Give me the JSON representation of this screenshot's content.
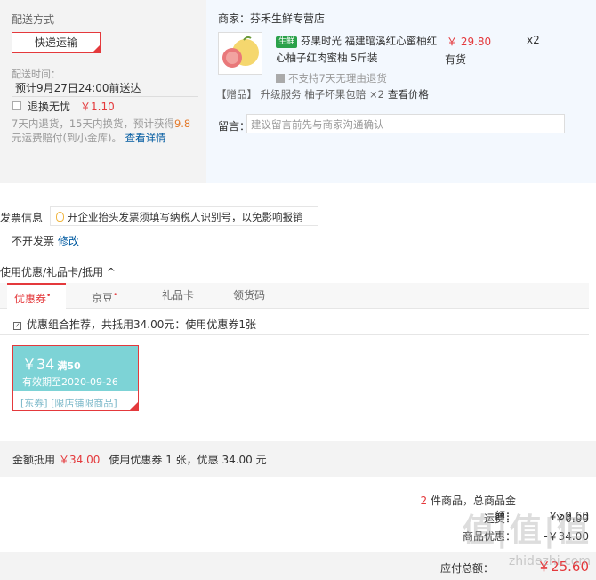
{
  "shipping": {
    "title": "配送方式",
    "mode": "快递运输",
    "time_label": "配送时间：",
    "time_value": "预计9月27日24:00前送达",
    "return_label": "退换无忧",
    "return_price": "￥1.10",
    "desc_pre": "7天内退货，15天内换货，预计获得",
    "desc_num": "9.8",
    "desc_post": "元运费赔付(到小金库)。",
    "detail_link": "查看详情"
  },
  "store": {
    "merchant": "商家：芬禾生鲜专营店",
    "badge": "生鲜",
    "product_title": "芬果时光 福建琯溪红心蜜柚红心柚子红肉蜜柚 5斤装",
    "price": "￥ 29.80",
    "qty": "x2",
    "stock": "有货",
    "no_return": "不支持7天无理由退货",
    "gift_tag": "【赠品】",
    "gift_text": "升级服务 柚子坏果包赔 ×2",
    "gift_link": "查看价格",
    "msg_label": "留言：",
    "msg_placeholder": "建议留言前先与商家沟通确认"
  },
  "invoice": {
    "title": "发票信息",
    "tip": "开企业抬头发票须填写纳税人识别号，以免影响报销",
    "status": "不开发票",
    "edit": "修改"
  },
  "coupons": {
    "title": "使用优惠/礼品卡/抵用 ^",
    "tabs": [
      {
        "label": "优惠券",
        "dot": "•"
      },
      {
        "label": "京豆",
        "dot": "•"
      },
      {
        "label": "礼品卡",
        "dot": ""
      },
      {
        "label": "领货码",
        "dot": ""
      }
    ],
    "combo": "优惠组合推荐，共抵用34.00元：使用优惠券1张",
    "coupon": {
      "amount": "￥34",
      "condition": "满50",
      "valid": "有效期至2020-09-26",
      "tags": "[东券]  [限店铺限商品]"
    },
    "summary_label": "金额抵用",
    "summary_amount": "￥34.00",
    "summary_text": "使用优惠券 1 张，优惠 34.00 元"
  },
  "totals": {
    "count": "2",
    "count_text": "件商品，总商品金额：",
    "goods_total": "￥59.60",
    "freight_label": "运费：",
    "freight_value": "￥0.00",
    "discount_label": "商品优惠：",
    "discount_value": "-￥34.00",
    "payable_label": "应付总额：",
    "payable_value": "￥25.60"
  },
  "watermark": {
    "big": "值|值|值",
    "small": "zhidezhi.com"
  }
}
